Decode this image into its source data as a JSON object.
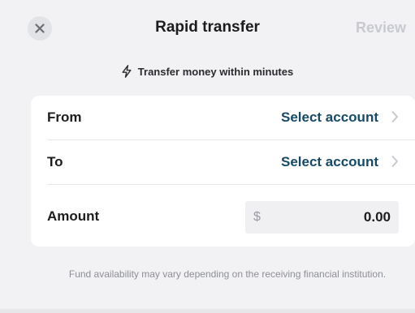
{
  "header": {
    "title": "Rapid transfer",
    "review_label": "Review",
    "close_icon": "close-icon"
  },
  "subtitle": {
    "text": "Transfer money within minutes",
    "icon": "lightning-bolt-icon"
  },
  "form": {
    "from": {
      "label": "From",
      "value": "Select account",
      "icon": "chevron-right-icon"
    },
    "to": {
      "label": "To",
      "value": "Select account",
      "icon": "chevron-right-icon"
    },
    "amount": {
      "label": "Amount",
      "currency_symbol": "$",
      "value": "0.00"
    }
  },
  "footer": {
    "note": "Fund availability may vary depending on the receiving financial institution."
  },
  "colors": {
    "background": "#f2f2f5",
    "card": "#ffffff",
    "accent_text": "#164a66",
    "muted_text": "#8d8f96",
    "disabled_text": "#c8cad0"
  }
}
